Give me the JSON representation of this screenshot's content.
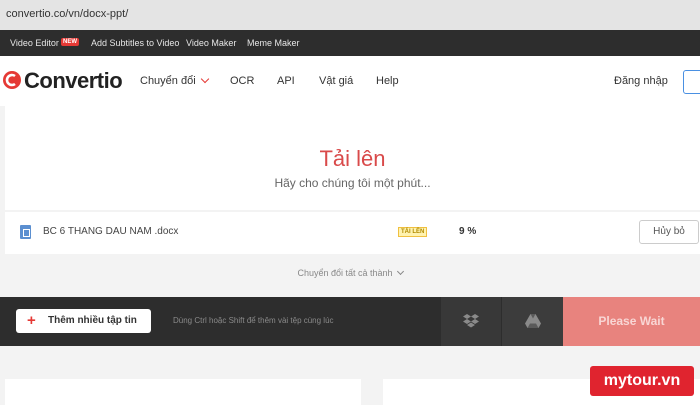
{
  "browser": {
    "url": "convertio.co/vn/docx-ppt/"
  },
  "topstrip": {
    "video_editor": "Video Editor",
    "new_badge": "NEW",
    "add_subtitles": "Add Subtitles to Video",
    "video_maker": "Video Maker",
    "meme_maker": "Meme Maker"
  },
  "nav": {
    "logo": "Convertio",
    "convert": "Chuyển đổi",
    "ocr": "OCR",
    "api": "API",
    "pricing": "Vật giá",
    "help": "Help",
    "login": "Đăng nhập"
  },
  "hero": {
    "title": "Tải lên",
    "subtitle": "Hãy cho chúng tôi một phút..."
  },
  "file": {
    "name": "BC 6 THANG DAU NAM .docx",
    "status": "TẢI LÊN",
    "progress": "9 %",
    "cancel": "Hủy bỏ"
  },
  "convert_all": "Chuyển đổi tất cả thành",
  "actionbar": {
    "add_more": "Thêm nhiều tập tin",
    "hint": "Dùng Ctrl hoặc Shift để thêm vài tệp cùng lúc",
    "wait": "Please Wait"
  },
  "watermark": "mytour.vn",
  "colors": {
    "brand": "#e53935",
    "wait_button": "#e8837e",
    "dark_bar": "#2d2d2d"
  }
}
